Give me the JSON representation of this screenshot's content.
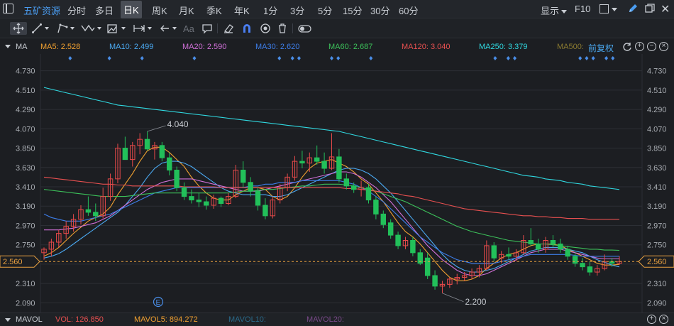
{
  "stock": {
    "name": "五矿资源"
  },
  "periods": [
    "分时",
    "多日",
    "日K",
    "周K",
    "月K",
    "季K",
    "年K",
    "1分",
    "3分",
    "5分",
    "15分",
    "30分",
    "60分"
  ],
  "active_period": "日K",
  "topbar": {
    "display_label": "显示",
    "f10_label": "F10"
  },
  "toolbar": {
    "tools": [
      "move-crosshair",
      "line",
      "polyline",
      "zigzag",
      "measure",
      "range",
      "back-arrow",
      "text",
      "comment",
      "eraser",
      "magnet",
      "eye",
      "trash",
      "toggle"
    ],
    "text_tool_label": "Aa"
  },
  "indicator": {
    "name": "MA",
    "lines": [
      {
        "label": "MA5: 2.528",
        "color": "#f0a030"
      },
      {
        "label": "MA10: 2.499",
        "color": "#4aa8f0"
      },
      {
        "label": "MA20: 2.590",
        "color": "#d070d8"
      },
      {
        "label": "MA30: 2.620",
        "color": "#3d7de8"
      },
      {
        "label": "MA60: 2.687",
        "color": "#3cc05a"
      },
      {
        "label": "MA120: 3.040",
        "color": "#e85050"
      },
      {
        "label": "MA250: 3.379",
        "color": "#30d8e0"
      },
      {
        "label": "MA500:",
        "color": "#8a7a30"
      }
    ],
    "adjust_label": "前复权"
  },
  "volume": {
    "name": "MAVOL",
    "vol_label": "VOL: 126.850",
    "mavol5_label": "MAVOL5: 894.272",
    "mavol10_label": "MAVOL10:",
    "mavol20_label": "MAVOL20:",
    "colors": {
      "vol": "#e85050",
      "mavol5": "#f0a030",
      "mavol10": "#2a6a8a",
      "mavol20": "#7a4a8a"
    }
  },
  "colors": {
    "up": "#e84a4a",
    "down": "#22c05a",
    "bg": "#1c1e22",
    "grid": "#2c2f35",
    "axis_text": "#a8acb2",
    "price_line": "#e8a040"
  },
  "chart_data": {
    "type": "candlestick",
    "y_ticks": [
      "4.730",
      "4.510",
      "4.290",
      "4.070",
      "3.850",
      "3.630",
      "3.410",
      "3.190",
      "2.970",
      "2.750",
      "2.530",
      "2.310",
      "2.090"
    ],
    "ylim": [
      1.98,
      4.84
    ],
    "current_price": "2.560",
    "max_label": "4.040",
    "min_label": "2.200",
    "event_marker": "E",
    "candles": [
      [
        2.66,
        2.72,
        2.58,
        2.7
      ],
      [
        2.7,
        2.82,
        2.62,
        2.78
      ],
      [
        2.78,
        2.92,
        2.72,
        2.88
      ],
      [
        2.88,
        3.02,
        2.82,
        2.96
      ],
      [
        2.96,
        3.1,
        2.9,
        3.04
      ],
      [
        3.04,
        3.2,
        2.98,
        3.15
      ],
      [
        3.15,
        3.3,
        3.08,
        3.12
      ],
      [
        3.12,
        3.22,
        3.02,
        3.08
      ],
      [
        3.08,
        3.4,
        3.05,
        3.3
      ],
      [
        3.3,
        3.56,
        3.25,
        3.5
      ],
      [
        3.5,
        3.9,
        3.45,
        3.85
      ],
      [
        3.85,
        3.98,
        3.74,
        3.72
      ],
      [
        3.72,
        3.92,
        3.64,
        3.88
      ],
      [
        3.88,
        4.02,
        3.78,
        3.95
      ],
      [
        3.95,
        4.04,
        3.82,
        3.84
      ],
      [
        3.84,
        3.92,
        3.72,
        3.88
      ],
      [
        3.88,
        3.92,
        3.7,
        3.74
      ],
      [
        3.74,
        3.8,
        3.54,
        3.6
      ],
      [
        3.6,
        3.64,
        3.36,
        3.4
      ],
      [
        3.4,
        3.46,
        3.26,
        3.3
      ],
      [
        3.3,
        3.38,
        3.22,
        3.26
      ],
      [
        3.26,
        3.34,
        3.18,
        3.24
      ],
      [
        3.24,
        3.3,
        3.15,
        3.2
      ],
      [
        3.2,
        3.32,
        3.16,
        3.28
      ],
      [
        3.28,
        3.3,
        3.18,
        3.22
      ],
      [
        3.22,
        3.34,
        3.2,
        3.3
      ],
      [
        3.3,
        3.66,
        3.28,
        3.6
      ],
      [
        3.6,
        3.7,
        3.4,
        3.46
      ],
      [
        3.46,
        3.52,
        3.3,
        3.36
      ],
      [
        3.36,
        3.4,
        3.14,
        3.2
      ],
      [
        3.2,
        3.28,
        3.04,
        3.08
      ],
      [
        3.08,
        3.3,
        3.05,
        3.26
      ],
      [
        3.26,
        3.44,
        3.22,
        3.4
      ],
      [
        3.4,
        3.56,
        3.36,
        3.52
      ],
      [
        3.52,
        3.76,
        3.48,
        3.7
      ],
      [
        3.7,
        3.82,
        3.62,
        3.68
      ],
      [
        3.68,
        3.8,
        3.58,
        3.74
      ],
      [
        3.74,
        3.88,
        3.66,
        3.7
      ],
      [
        3.7,
        3.8,
        3.56,
        3.62
      ],
      [
        3.62,
        4.02,
        3.6,
        3.75
      ],
      [
        3.75,
        3.84,
        3.46,
        3.5
      ],
      [
        3.5,
        3.56,
        3.38,
        3.42
      ],
      [
        3.42,
        3.46,
        3.34,
        3.38
      ],
      [
        3.38,
        3.48,
        3.3,
        3.4
      ],
      [
        3.4,
        3.44,
        3.22,
        3.26
      ],
      [
        3.26,
        3.3,
        3.04,
        3.1
      ],
      [
        3.1,
        3.14,
        2.94,
        2.98
      ],
      [
        3.0,
        3.04,
        2.82,
        2.86
      ],
      [
        2.86,
        2.9,
        2.7,
        2.74
      ],
      [
        2.74,
        2.84,
        2.7,
        2.8
      ],
      [
        2.8,
        2.84,
        2.62,
        2.66
      ],
      [
        2.66,
        2.7,
        2.52,
        2.54
      ],
      [
        2.6,
        2.66,
        2.36,
        2.4
      ],
      [
        2.4,
        2.46,
        2.24,
        2.28
      ],
      [
        2.28,
        2.34,
        2.2,
        2.3
      ],
      [
        2.3,
        2.38,
        2.26,
        2.36
      ],
      [
        2.36,
        2.42,
        2.3,
        2.38
      ],
      [
        2.38,
        2.44,
        2.34,
        2.4
      ],
      [
        2.4,
        2.48,
        2.36,
        2.44
      ],
      [
        2.44,
        2.52,
        2.38,
        2.48
      ],
      [
        2.48,
        2.8,
        2.46,
        2.74
      ],
      [
        2.74,
        2.78,
        2.56,
        2.6
      ],
      [
        2.6,
        2.68,
        2.54,
        2.64
      ],
      [
        2.64,
        2.72,
        2.58,
        2.62
      ],
      [
        2.62,
        2.7,
        2.56,
        2.66
      ],
      [
        2.66,
        2.86,
        2.64,
        2.8
      ],
      [
        2.8,
        2.94,
        2.74,
        2.76
      ],
      [
        2.76,
        2.82,
        2.66,
        2.7
      ],
      [
        2.7,
        2.84,
        2.66,
        2.8
      ],
      [
        2.8,
        2.86,
        2.72,
        2.76
      ],
      [
        2.76,
        2.82,
        2.66,
        2.7
      ],
      [
        2.7,
        2.74,
        2.58,
        2.62
      ],
      [
        2.62,
        2.66,
        2.5,
        2.54
      ],
      [
        2.54,
        2.6,
        2.46,
        2.5
      ],
      [
        2.5,
        2.56,
        2.4,
        2.44
      ],
      [
        2.44,
        2.52,
        2.4,
        2.48
      ],
      [
        2.48,
        2.64,
        2.46,
        2.56
      ],
      [
        2.56,
        2.6,
        2.5,
        2.54
      ],
      [
        2.54,
        2.62,
        2.52,
        2.56
      ]
    ],
    "ma_series": [
      {
        "name": "MA5",
        "color": "#f0a030",
        "values": [
          2.62,
          2.66,
          2.72,
          2.8,
          2.88,
          2.95,
          3.02,
          3.06,
          3.1,
          3.18,
          3.32,
          3.44,
          3.56,
          3.7,
          3.82,
          3.86,
          3.86,
          3.8,
          3.72,
          3.64,
          3.52,
          3.42,
          3.34,
          3.28,
          3.26,
          3.26,
          3.32,
          3.36,
          3.4,
          3.4,
          3.38,
          3.3,
          3.26,
          3.3,
          3.4,
          3.52,
          3.62,
          3.68,
          3.7,
          3.72,
          3.68,
          3.64,
          3.58,
          3.5,
          3.44,
          3.34,
          3.24,
          3.12,
          3.0,
          2.9,
          2.84,
          2.76,
          2.66,
          2.56,
          2.46,
          2.38,
          2.34,
          2.34,
          2.36,
          2.4,
          2.48,
          2.54,
          2.6,
          2.64,
          2.66,
          2.7,
          2.74,
          2.76,
          2.76,
          2.76,
          2.74,
          2.7,
          2.66,
          2.62,
          2.58,
          2.54,
          2.52,
          2.52,
          2.528
        ]
      },
      {
        "name": "MA10",
        "color": "#4aa8f0",
        "values": [
          2.6,
          2.62,
          2.65,
          2.7,
          2.76,
          2.82,
          2.88,
          2.94,
          3.0,
          3.06,
          3.12,
          3.2,
          3.3,
          3.4,
          3.52,
          3.62,
          3.68,
          3.7,
          3.7,
          3.68,
          3.64,
          3.58,
          3.52,
          3.46,
          3.4,
          3.36,
          3.34,
          3.32,
          3.32,
          3.32,
          3.32,
          3.3,
          3.3,
          3.32,
          3.36,
          3.4,
          3.44,
          3.48,
          3.52,
          3.56,
          3.6,
          3.62,
          3.62,
          3.6,
          3.56,
          3.5,
          3.42,
          3.34,
          3.24,
          3.14,
          3.04,
          2.94,
          2.84,
          2.74,
          2.64,
          2.56,
          2.5,
          2.46,
          2.44,
          2.44,
          2.46,
          2.48,
          2.52,
          2.56,
          2.6,
          2.64,
          2.68,
          2.7,
          2.72,
          2.72,
          2.72,
          2.7,
          2.68,
          2.66,
          2.62,
          2.58,
          2.55,
          2.52,
          2.499
        ]
      },
      {
        "name": "MA20",
        "color": "#d070d8",
        "values": [
          2.92,
          2.92,
          2.92,
          2.93,
          2.94,
          2.96,
          2.98,
          3.0,
          3.04,
          3.08,
          3.14,
          3.2,
          3.26,
          3.32,
          3.38,
          3.42,
          3.46,
          3.48,
          3.5,
          3.5,
          3.5,
          3.48,
          3.46,
          3.44,
          3.42,
          3.4,
          3.38,
          3.36,
          3.36,
          3.36,
          3.38,
          3.4,
          3.42,
          3.44,
          3.46,
          3.48,
          3.5,
          3.52,
          3.54,
          3.56,
          3.58,
          3.58,
          3.56,
          3.52,
          3.46,
          3.4,
          3.32,
          3.24,
          3.14,
          3.04,
          2.94,
          2.84,
          2.74,
          2.66,
          2.58,
          2.52,
          2.46,
          2.42,
          2.4,
          2.4,
          2.42,
          2.46,
          2.5,
          2.54,
          2.58,
          2.62,
          2.66,
          2.68,
          2.7,
          2.7,
          2.7,
          2.68,
          2.66,
          2.64,
          2.62,
          2.6,
          2.59,
          2.59,
          2.59
        ]
      },
      {
        "name": "MA30",
        "color": "#3d7de8",
        "values": [
          3.1,
          3.06,
          3.04,
          3.02,
          3.02,
          3.02,
          3.04,
          3.06,
          3.08,
          3.1,
          3.14,
          3.18,
          3.22,
          3.26,
          3.3,
          3.34,
          3.36,
          3.38,
          3.4,
          3.4,
          3.4,
          3.4,
          3.4,
          3.4,
          3.4,
          3.4,
          3.4,
          3.4,
          3.42,
          3.42,
          3.44,
          3.44,
          3.46,
          3.46,
          3.46,
          3.48,
          3.48,
          3.48,
          3.48,
          3.48,
          3.48,
          3.46,
          3.44,
          3.4,
          3.36,
          3.3,
          3.24,
          3.16,
          3.08,
          3.0,
          2.92,
          2.84,
          2.78,
          2.72,
          2.66,
          2.62,
          2.58,
          2.56,
          2.54,
          2.54,
          2.54,
          2.54,
          2.56,
          2.58,
          2.6,
          2.62,
          2.64,
          2.64,
          2.64,
          2.64,
          2.64,
          2.64,
          2.63,
          2.62,
          2.62,
          2.62,
          2.62,
          2.62,
          2.62
        ]
      },
      {
        "name": "MA60",
        "color": "#3cc05a",
        "values": [
          3.38,
          3.37,
          3.36,
          3.35,
          3.34,
          3.33,
          3.32,
          3.31,
          3.3,
          3.3,
          3.3,
          3.3,
          3.31,
          3.32,
          3.33,
          3.34,
          3.34,
          3.34,
          3.34,
          3.34,
          3.34,
          3.34,
          3.34,
          3.34,
          3.34,
          3.34,
          3.35,
          3.36,
          3.36,
          3.37,
          3.38,
          3.38,
          3.39,
          3.4,
          3.41,
          3.42,
          3.42,
          3.43,
          3.44,
          3.44,
          3.44,
          3.43,
          3.42,
          3.4,
          3.38,
          3.36,
          3.33,
          3.3,
          3.27,
          3.24,
          3.2,
          3.16,
          3.12,
          3.08,
          3.04,
          3.0,
          2.96,
          2.93,
          2.9,
          2.88,
          2.86,
          2.84,
          2.82,
          2.8,
          2.79,
          2.78,
          2.77,
          2.76,
          2.76,
          2.75,
          2.74,
          2.73,
          2.72,
          2.71,
          2.7,
          2.7,
          2.69,
          2.69,
          2.687
        ]
      },
      {
        "name": "MA120",
        "color": "#e85050",
        "values": [
          3.52,
          3.51,
          3.5,
          3.49,
          3.48,
          3.47,
          3.46,
          3.45,
          3.44,
          3.44,
          3.43,
          3.43,
          3.42,
          3.42,
          3.42,
          3.42,
          3.42,
          3.42,
          3.42,
          3.41,
          3.41,
          3.41,
          3.41,
          3.41,
          3.4,
          3.4,
          3.4,
          3.4,
          3.4,
          3.4,
          3.4,
          3.4,
          3.4,
          3.4,
          3.4,
          3.4,
          3.4,
          3.4,
          3.4,
          3.4,
          3.4,
          3.39,
          3.39,
          3.38,
          3.37,
          3.36,
          3.35,
          3.34,
          3.33,
          3.31,
          3.3,
          3.28,
          3.26,
          3.24,
          3.22,
          3.2,
          3.18,
          3.16,
          3.15,
          3.14,
          3.13,
          3.12,
          3.11,
          3.1,
          3.09,
          3.08,
          3.08,
          3.07,
          3.07,
          3.06,
          3.06,
          3.05,
          3.05,
          3.05,
          3.04,
          3.04,
          3.04,
          3.04,
          3.04
        ]
      },
      {
        "name": "MA250",
        "color": "#30d8e0",
        "values": [
          4.54,
          4.52,
          4.5,
          4.48,
          4.46,
          4.44,
          4.42,
          4.4,
          4.38,
          4.36,
          4.34,
          4.33,
          4.32,
          4.31,
          4.3,
          4.29,
          4.28,
          4.27,
          4.26,
          4.25,
          4.24,
          4.23,
          4.22,
          4.21,
          4.2,
          4.19,
          4.18,
          4.17,
          4.16,
          4.15,
          4.14,
          4.13,
          4.12,
          4.11,
          4.1,
          4.09,
          4.08,
          4.07,
          4.06,
          4.05,
          4.04,
          4.02,
          4.0,
          3.98,
          3.96,
          3.94,
          3.92,
          3.9,
          3.88,
          3.86,
          3.84,
          3.82,
          3.8,
          3.78,
          3.76,
          3.74,
          3.72,
          3.7,
          3.68,
          3.66,
          3.64,
          3.62,
          3.6,
          3.58,
          3.56,
          3.54,
          3.53,
          3.52,
          3.5,
          3.49,
          3.48,
          3.46,
          3.45,
          3.44,
          3.42,
          3.41,
          3.4,
          3.39,
          3.379
        ]
      }
    ],
    "flag_markers": [
      4,
      10,
      15,
      23,
      36,
      38,
      39,
      44,
      45,
      50,
      69,
      71,
      72,
      82,
      83,
      84,
      86,
      87
    ]
  }
}
